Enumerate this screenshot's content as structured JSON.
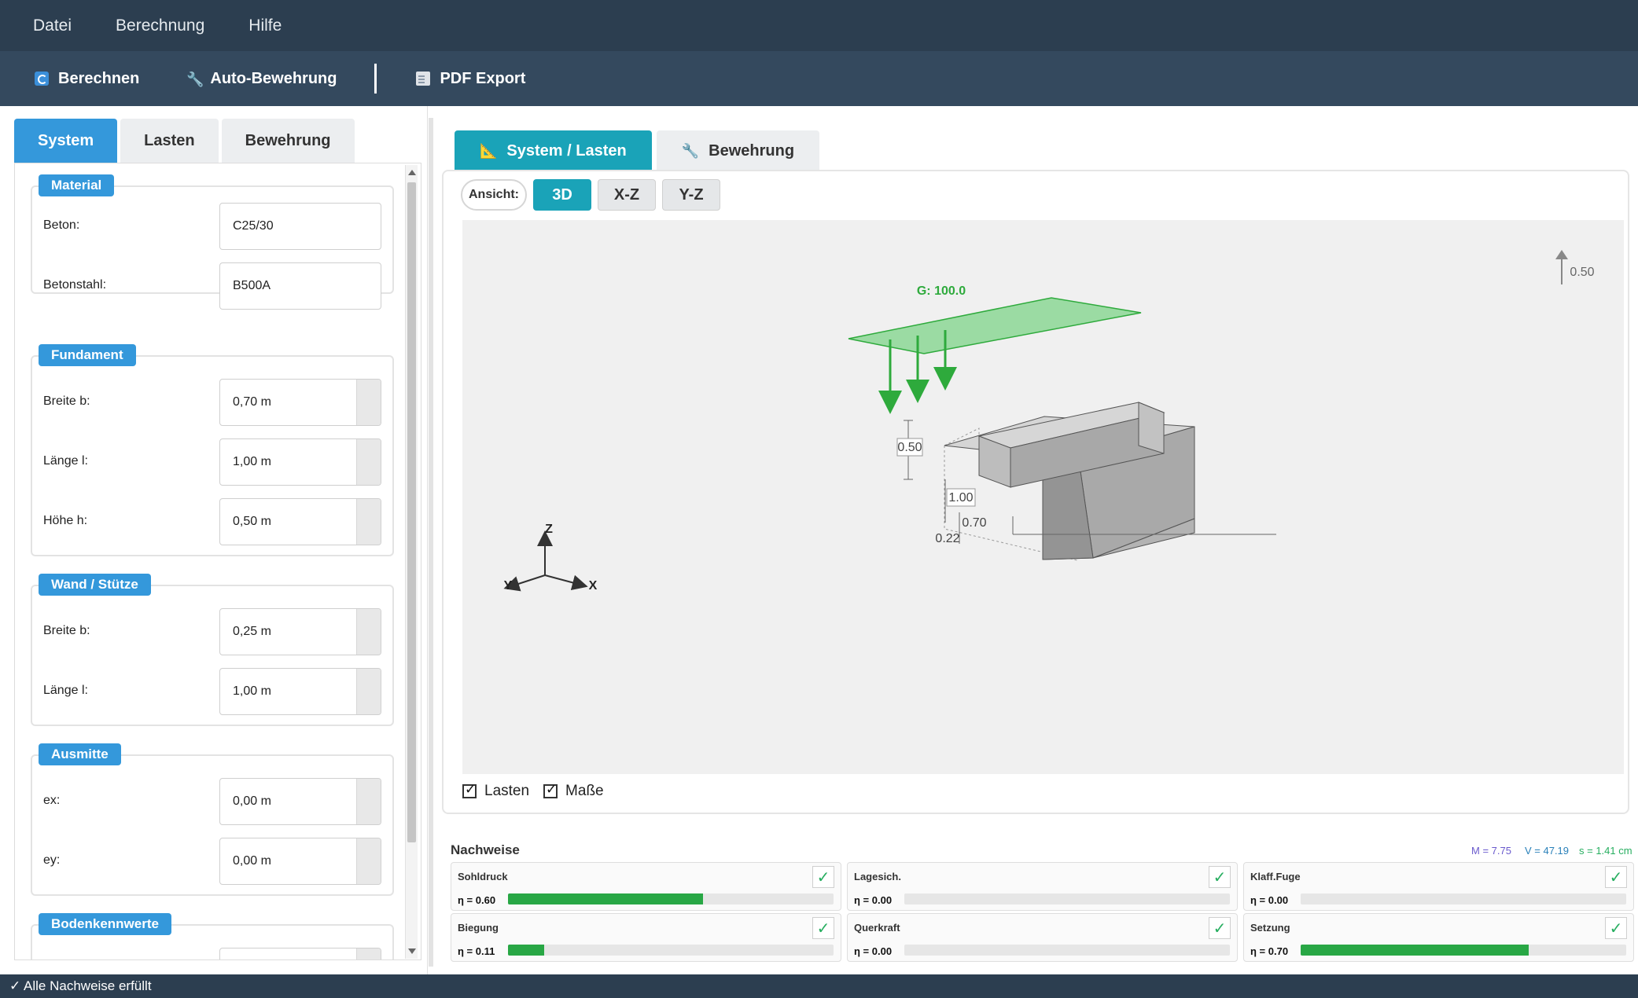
{
  "menu": [
    "Datei",
    "Berechnung",
    "Hilfe"
  ],
  "toolbar": {
    "calc": "Berechnen",
    "auto": "Auto-Bewehrung",
    "pdf": "PDF Export"
  },
  "left_tabs": [
    "System",
    "Lasten",
    "Bewehrung"
  ],
  "material": {
    "label": "Material",
    "beton_label": "Beton:",
    "beton_value": "C25/30",
    "stahl_label": "Betonstahl:",
    "stahl_value": "B500A"
  },
  "fundament": {
    "label": "Fundament",
    "breite_label": "Breite b:",
    "breite_value": "0,70 m",
    "laenge_label": "Länge l:",
    "laenge_value": "1,00 m",
    "hoehe_label": "Höhe h:",
    "hoehe_value": "0,50 m"
  },
  "wand": {
    "label": "Wand / Stütze",
    "breite_label": "Breite b:",
    "breite_value": "0,25 m",
    "laenge_label": "Länge l:",
    "laenge_value": "1,00 m"
  },
  "ausmitte": {
    "label": "Ausmitte",
    "ex_label": "ex:",
    "ex_value": "0,00 m",
    "ey_label": "ey:",
    "ey_value": "0,00 m"
  },
  "boden": {
    "label": "Bodenkennwerte"
  },
  "right_tabs": [
    "System / Lasten",
    "Bewehrung"
  ],
  "view": {
    "label": "Ansicht:",
    "buttons": [
      "3D",
      "X-Z",
      "Y-Z"
    ],
    "active": "3D"
  },
  "scene": {
    "load_label": "G: 100.0",
    "dim_height": "0.50",
    "dim_length": "1.00",
    "dim_width": "0.70",
    "dim_wall": "0.22",
    "scale_value": "0.50",
    "axis_z": "Z",
    "axis_y": "Y",
    "axis_x": "X",
    "colors": {
      "load": "#2ecc40",
      "body": "#b8b8b8",
      "canvas": "#f0f0f0"
    }
  },
  "checkboxes": [
    {
      "label": "Lasten",
      "checked": true
    },
    {
      "label": "Maße",
      "checked": true
    }
  ],
  "nachweise": {
    "title": "Nachweise",
    "stat_m": "M = 7.75",
    "stat_v": "V = 47.19",
    "stat_s": "s = 1.41 cm",
    "cards": [
      {
        "title": "Sohldruck",
        "eta": "η = 0.60",
        "ratio": 0.6,
        "ok": true
      },
      {
        "title": "Lagesich.",
        "eta": "η = 0.00",
        "ratio": 0.0,
        "ok": true
      },
      {
        "title": "Klaff.Fuge",
        "eta": "η = 0.00",
        "ratio": 0.0,
        "ok": true
      },
      {
        "title": "Biegung",
        "eta": "η = 0.11",
        "ratio": 0.11,
        "ok": true
      },
      {
        "title": "Querkraft",
        "eta": "η = 0.00",
        "ratio": 0.0,
        "ok": true
      },
      {
        "title": "Setzung",
        "eta": "η = 0.70",
        "ratio": 0.7,
        "ok": true
      }
    ],
    "check_glyph": "✓"
  },
  "status": "✓ Alle Nachweise erfüllt"
}
